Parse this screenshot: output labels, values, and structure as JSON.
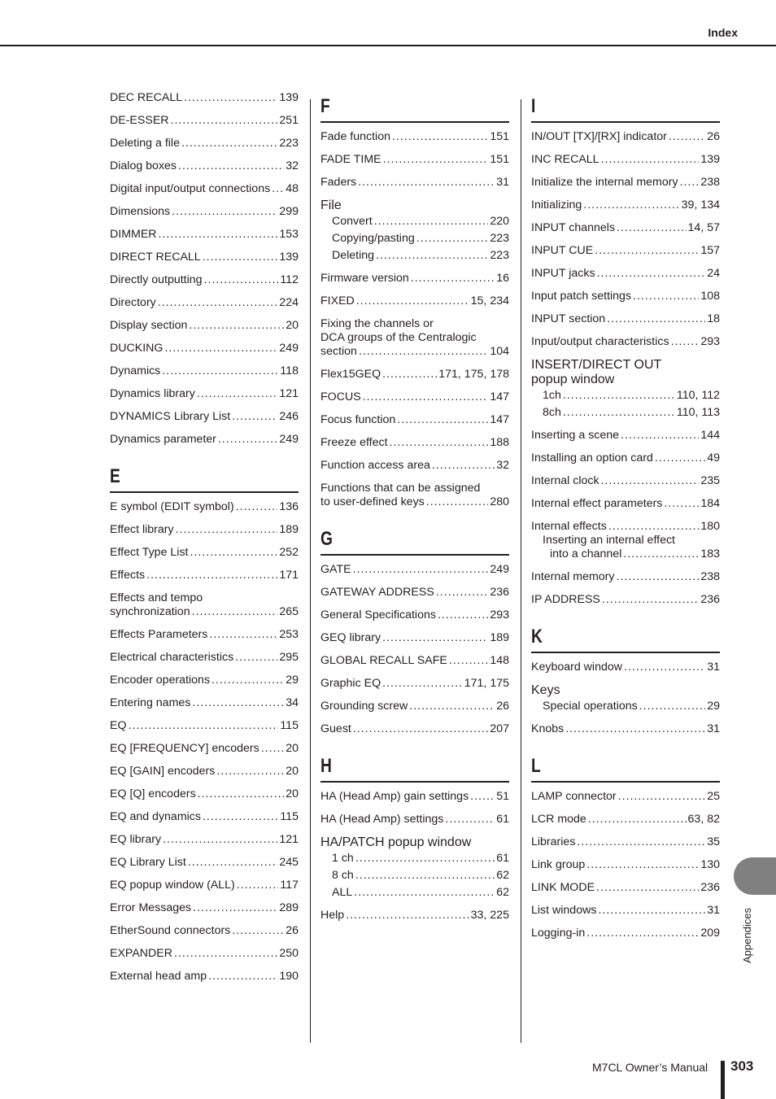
{
  "header": {
    "title": "Index"
  },
  "columns": [
    {
      "sections": [
        {
          "letter": "",
          "entries": [
            {
              "term": "DEC RECALL",
              "page": "139"
            },
            {
              "term": "DE-ESSER",
              "page": "251"
            },
            {
              "term": "Deleting a file",
              "page": "223"
            },
            {
              "term": "Dialog boxes",
              "page": "32"
            },
            {
              "term": "Digital input/output connections",
              "page": "48"
            },
            {
              "term": "Dimensions",
              "page": "299"
            },
            {
              "term": "DIMMER",
              "page": "153"
            },
            {
              "term": "DIRECT RECALL",
              "page": "139"
            },
            {
              "term": "Directly outputting",
              "page": "112"
            },
            {
              "term": "Directory",
              "page": "224"
            },
            {
              "term": "Display section",
              "page": "20"
            },
            {
              "term": "DUCKING",
              "page": "249"
            },
            {
              "term": "Dynamics",
              "page": "118"
            },
            {
              "term": "Dynamics library",
              "page": "121"
            },
            {
              "term": "DYNAMICS Library List",
              "page": "246"
            },
            {
              "term": "Dynamics parameter",
              "page": "249"
            }
          ]
        },
        {
          "letter": "E",
          "entries": [
            {
              "term": "E symbol (EDIT symbol)",
              "page": "136"
            },
            {
              "term": "Effect library",
              "page": "189"
            },
            {
              "term": "Effect Type List",
              "page": "252"
            },
            {
              "term": "Effects",
              "page": "171"
            },
            {
              "term_lead": "Effects and tempo",
              "term": "synchronization",
              "page": "265"
            },
            {
              "term": "Effects Parameters",
              "page": "253"
            },
            {
              "term": "Electrical characteristics",
              "page": "295"
            },
            {
              "term": "Encoder operations",
              "page": "29"
            },
            {
              "term": "Entering names",
              "page": "34"
            },
            {
              "term": "EQ",
              "page": "115"
            },
            {
              "term": "EQ [FREQUENCY] encoders",
              "page": "20"
            },
            {
              "term": "EQ [GAIN] encoders",
              "page": "20"
            },
            {
              "term": "EQ [Q] encoders",
              "page": "20"
            },
            {
              "term": "EQ and dynamics",
              "page": "115"
            },
            {
              "term": "EQ library",
              "page": "121"
            },
            {
              "term": "EQ Library List",
              "page": "245"
            },
            {
              "term": "EQ popup window (ALL)",
              "page": "117"
            },
            {
              "term": "Error Messages",
              "page": "289"
            },
            {
              "term": "EtherSound connectors",
              "page": "26"
            },
            {
              "term": "EXPANDER",
              "page": "250"
            },
            {
              "term": "External head amp",
              "page": "190"
            }
          ]
        }
      ]
    },
    {
      "sections": [
        {
          "letter": "F",
          "entries": [
            {
              "term": "Fade function",
              "page": "151"
            },
            {
              "term": "FADE TIME",
              "page": "151"
            },
            {
              "term": "Faders",
              "page": "31"
            },
            {
              "group": "File",
              "subs": [
                {
                  "term": "Convert",
                  "page": "220"
                },
                {
                  "term": "Copying/pasting",
                  "page": "223"
                },
                {
                  "term": "Deleting",
                  "page": "223"
                }
              ]
            },
            {
              "term": "Firmware version",
              "page": "16"
            },
            {
              "term": "FIXED",
              "page": "15, 234"
            },
            {
              "term_lead": "Fixing the channels or",
              "term_lead2": "DCA groups of the Centralogic",
              "term": "section",
              "page": "104"
            },
            {
              "term": "Flex15GEQ",
              "page": "171, 175, 178"
            },
            {
              "term": "FOCUS",
              "page": "147"
            },
            {
              "term": "Focus function",
              "page": "147"
            },
            {
              "term": "Freeze effect",
              "page": "188"
            },
            {
              "term": "Function access area",
              "page": "32"
            },
            {
              "term_lead": "Functions that can be assigned",
              "term": "to user-defined keys",
              "page": "280"
            }
          ]
        },
        {
          "letter": "G",
          "entries": [
            {
              "term": "GATE",
              "page": "249"
            },
            {
              "term": "GATEWAY ADDRESS",
              "page": "236"
            },
            {
              "term": "General Specifications",
              "page": "293"
            },
            {
              "term": "GEQ library",
              "page": "189"
            },
            {
              "term": "GLOBAL RECALL SAFE",
              "page": "148"
            },
            {
              "term": "Graphic EQ",
              "page": "171, 175"
            },
            {
              "term": "Grounding screw",
              "page": "26"
            },
            {
              "term": "Guest",
              "page": "207"
            }
          ]
        },
        {
          "letter": "H",
          "entries": [
            {
              "term": "HA (Head Amp) gain settings",
              "page": "51"
            },
            {
              "term": "HA (Head Amp) settings",
              "page": "61"
            },
            {
              "group": "HA/PATCH popup window",
              "subs": [
                {
                  "term": "1 ch",
                  "page": "61"
                },
                {
                  "term": "8 ch",
                  "page": "62"
                },
                {
                  "term": "ALL",
                  "page": "62"
                }
              ]
            },
            {
              "term": "Help",
              "page": "33, 225"
            }
          ]
        }
      ]
    },
    {
      "sections": [
        {
          "letter": "I",
          "entries": [
            {
              "term": "IN/OUT [TX]/[RX] indicator",
              "page": "26"
            },
            {
              "term": "INC RECALL",
              "page": "139"
            },
            {
              "term": "Initialize the internal memory",
              "page": "238"
            },
            {
              "term": "Initializing",
              "page": "39, 134"
            },
            {
              "term": "INPUT channels",
              "page": "14, 57"
            },
            {
              "term": "INPUT CUE",
              "page": "157"
            },
            {
              "term": "INPUT jacks",
              "page": "24"
            },
            {
              "term": "Input patch settings",
              "page": "108"
            },
            {
              "term": "INPUT section",
              "page": "18"
            },
            {
              "term": "Input/output characteristics",
              "page": "293"
            },
            {
              "group": "INSERT/DIRECT OUT",
              "group2": "popup window",
              "subs": [
                {
                  "term": "1ch",
                  "page": "110, 112"
                },
                {
                  "term": "8ch",
                  "page": "110, 113"
                }
              ]
            },
            {
              "term": "Inserting a scene",
              "page": "144"
            },
            {
              "term": "Installing an option card",
              "page": "49"
            },
            {
              "term": "Internal clock",
              "page": "235"
            },
            {
              "term": "Internal effect parameters",
              "page": "184"
            },
            {
              "term": "Internal effects",
              "page": "180",
              "subs_nested": [
                {
                  "term_lead": "Inserting an internal effect",
                  "term": "into a channel",
                  "page": "183"
                }
              ]
            },
            {
              "term": "Internal memory",
              "page": "238"
            },
            {
              "term": "IP ADDRESS",
              "page": "236"
            }
          ]
        },
        {
          "letter": "K",
          "entries": [
            {
              "term": "Keyboard window",
              "page": "31"
            },
            {
              "group": "Keys",
              "subs": [
                {
                  "term": "Special operations",
                  "page": "29"
                }
              ]
            },
            {
              "term": "Knobs",
              "page": "31"
            }
          ]
        },
        {
          "letter": "L",
          "entries": [
            {
              "term": "LAMP connector",
              "page": "25"
            },
            {
              "term": "LCR mode",
              "page": "63, 82"
            },
            {
              "term": "Libraries",
              "page": "35"
            },
            {
              "term": "Link group",
              "page": "130"
            },
            {
              "term": "LINK MODE",
              "page": "236"
            },
            {
              "term": "List windows",
              "page": "31"
            },
            {
              "term": "Logging-in",
              "page": "209"
            }
          ]
        }
      ]
    }
  ],
  "side_tab": {
    "label": "Appendices",
    "color": "#808080"
  },
  "footer": {
    "manual": "M7CL  Owner’s Manual",
    "page_number": "303"
  }
}
